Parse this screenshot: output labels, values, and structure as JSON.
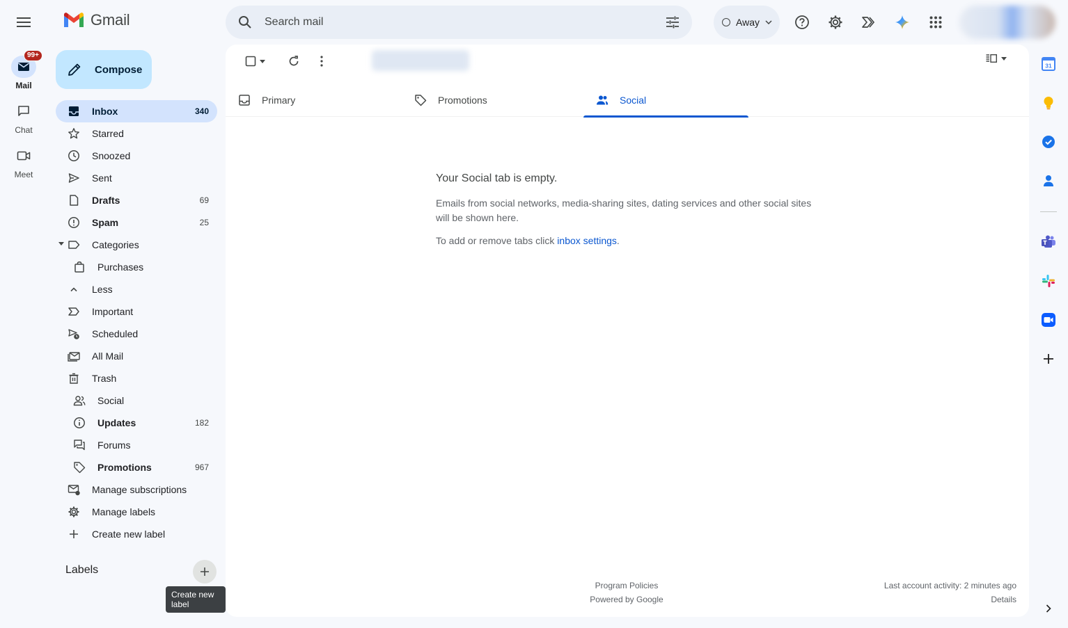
{
  "app": {
    "name": "Gmail"
  },
  "rail": {
    "items": [
      {
        "label": "Mail",
        "badge": "99+"
      },
      {
        "label": "Chat"
      },
      {
        "label": "Meet"
      }
    ]
  },
  "compose": {
    "label": "Compose"
  },
  "nav": {
    "items": [
      {
        "label": "Inbox",
        "count": "340"
      },
      {
        "label": "Starred",
        "count": ""
      },
      {
        "label": "Snoozed",
        "count": ""
      },
      {
        "label": "Sent",
        "count": ""
      },
      {
        "label": "Drafts",
        "count": "69"
      },
      {
        "label": "Spam",
        "count": "25"
      },
      {
        "label": "Categories",
        "count": ""
      },
      {
        "label": "Purchases",
        "count": ""
      },
      {
        "label": "Less",
        "count": ""
      },
      {
        "label": "Important",
        "count": ""
      },
      {
        "label": "Scheduled",
        "count": ""
      },
      {
        "label": "All Mail",
        "count": ""
      },
      {
        "label": "Trash",
        "count": ""
      },
      {
        "label": "Social",
        "count": ""
      },
      {
        "label": "Updates",
        "count": "182"
      },
      {
        "label": "Forums",
        "count": ""
      },
      {
        "label": "Promotions",
        "count": "967"
      },
      {
        "label": "Manage subscriptions",
        "count": ""
      },
      {
        "label": "Manage labels",
        "count": ""
      },
      {
        "label": "Create new label",
        "count": ""
      }
    ]
  },
  "labels": {
    "heading": "Labels",
    "tooltip": "Create new label"
  },
  "search": {
    "placeholder": "Search mail"
  },
  "status": {
    "label": "Away"
  },
  "tabs": [
    {
      "label": "Primary"
    },
    {
      "label": "Promotions"
    },
    {
      "label": "Social"
    }
  ],
  "empty": {
    "title": "Your Social tab is empty.",
    "description": "Emails from social networks, media-sharing sites, dating services and other social sites will be shown here.",
    "hint_prefix": "To add or remove tabs click ",
    "hint_link": "inbox settings",
    "hint_suffix": "."
  },
  "footer": {
    "program_policies": "Program Policies",
    "powered_by": "Powered by Google",
    "last_activity": "Last account activity: 2 minutes ago",
    "details": "Details"
  },
  "side_panel": {
    "calendar_day": "31"
  },
  "colors": {
    "accent": "#0b57d0",
    "compose_bg": "#c2e7ff",
    "active_nav": "#d3e3fd",
    "badge": "#b3261e",
    "background": "#f6f8fc"
  }
}
